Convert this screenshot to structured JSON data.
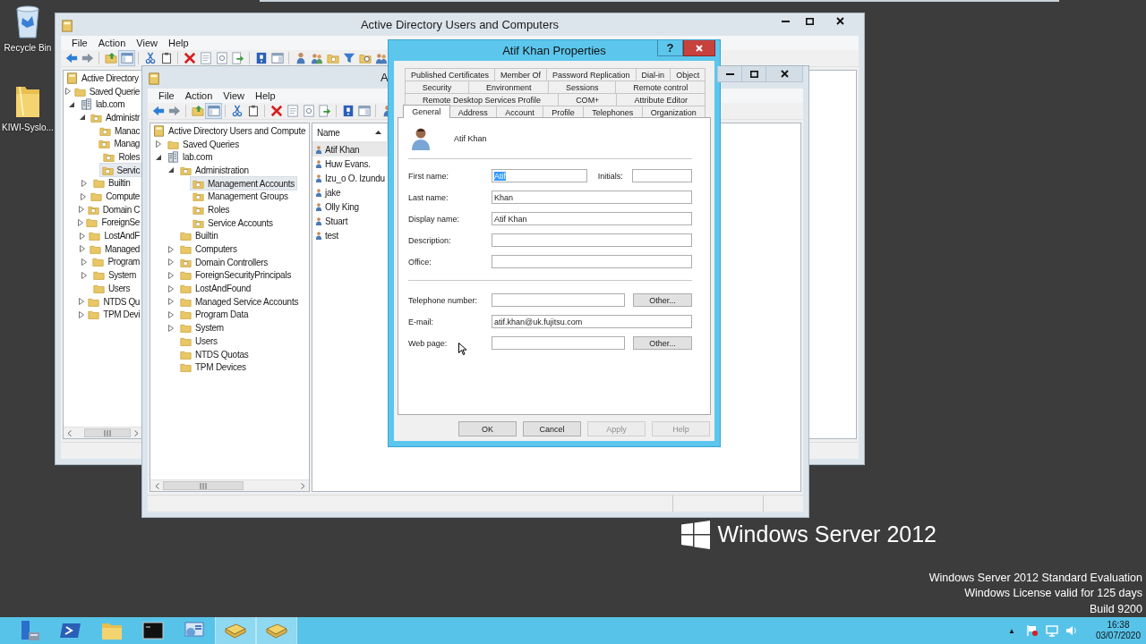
{
  "desktop_icons": [
    {
      "label": "Recycle Bin",
      "kind": "recycle-bin"
    },
    {
      "label": "KIWI-Syslo...",
      "kind": "folder"
    }
  ],
  "back_window": {
    "title": "Active Directory Users and Computers",
    "menu": [
      "File",
      "Action",
      "View",
      "Help"
    ],
    "tree": [
      {
        "label": "Active Directory",
        "kind": "root",
        "selected": false,
        "children": [
          {
            "label": "Saved Querie",
            "kind": "folder",
            "expanded": false,
            "selected": false
          },
          {
            "label": "lab.com",
            "kind": "domain",
            "expanded": true,
            "selected": false,
            "children": [
              {
                "label": "Administr",
                "kind": "ou",
                "expanded": true,
                "selected": false,
                "children": [
                  {
                    "label": "Manac",
                    "kind": "ou",
                    "selected": false
                  },
                  {
                    "label": "Manag",
                    "kind": "ou",
                    "selected": false
                  },
                  {
                    "label": "Roles",
                    "kind": "ou",
                    "selected": false
                  },
                  {
                    "label": "Servic",
                    "kind": "ou",
                    "selected": true
                  }
                ]
              },
              {
                "label": "Builtin",
                "kind": "folder",
                "expanded": false,
                "selected": false
              },
              {
                "label": "Compute",
                "kind": "folder",
                "expanded": false,
                "selected": false
              },
              {
                "label": "Domain C",
                "kind": "ou",
                "expanded": false,
                "selected": false
              },
              {
                "label": "ForeignSe",
                "kind": "folder",
                "expanded": false,
                "selected": false
              },
              {
                "label": "LostAndF",
                "kind": "folder",
                "expanded": false,
                "selected": false
              },
              {
                "label": "Managed",
                "kind": "folder",
                "expanded": false,
                "selected": false
              },
              {
                "label": "Program",
                "kind": "folder",
                "expanded": false,
                "selected": false
              },
              {
                "label": "System",
                "kind": "folder",
                "expanded": false,
                "selected": false
              },
              {
                "label": "Users",
                "kind": "folder",
                "selected": false
              },
              {
                "label": "NTDS Qu",
                "kind": "folder",
                "expanded": false,
                "selected": false
              },
              {
                "label": "TPM Devi",
                "kind": "folder",
                "expanded": false,
                "selected": false
              }
            ]
          }
        ]
      }
    ]
  },
  "front_window": {
    "title": "A",
    "menu": [
      "File",
      "Action",
      "View",
      "Help"
    ],
    "tree": [
      {
        "label": "Active Directory Users and Compute",
        "kind": "root",
        "selected": false,
        "children": [
          {
            "label": "Saved Queries",
            "kind": "folder",
            "expanded": false,
            "selected": false
          },
          {
            "label": "lab.com",
            "kind": "domain",
            "expanded": true,
            "selected": false,
            "children": [
              {
                "label": "Administration",
                "kind": "ou",
                "expanded": true,
                "selected": false,
                "children": [
                  {
                    "label": "Management Accounts",
                    "kind": "ou",
                    "selected": true
                  },
                  {
                    "label": "Management Groups",
                    "kind": "ou",
                    "selected": false
                  },
                  {
                    "label": "Roles",
                    "kind": "ou",
                    "selected": false
                  },
                  {
                    "label": "Service Accounts",
                    "kind": "ou",
                    "selected": false
                  }
                ]
              },
              {
                "label": "Builtin",
                "kind": "folder",
                "selected": false
              },
              {
                "label": "Computers",
                "kind": "folder",
                "expanded": false,
                "selected": false
              },
              {
                "label": "Domain Controllers",
                "kind": "ou",
                "expanded": false,
                "selected": false
              },
              {
                "label": "ForeignSecurityPrincipals",
                "kind": "folder",
                "expanded": false,
                "selected": false
              },
              {
                "label": "LostAndFound",
                "kind": "folder",
                "expanded": false,
                "selected": false
              },
              {
                "label": "Managed Service Accounts",
                "kind": "folder",
                "expanded": false,
                "selected": false
              },
              {
                "label": "Program Data",
                "kind": "folder",
                "expanded": false,
                "selected": false
              },
              {
                "label": "System",
                "kind": "folder",
                "expanded": false,
                "selected": false
              },
              {
                "label": "Users",
                "kind": "folder",
                "selected": false
              },
              {
                "label": "NTDS Quotas",
                "kind": "folder",
                "selected": false
              },
              {
                "label": "TPM Devices",
                "kind": "folder",
                "selected": false
              }
            ]
          }
        ]
      }
    ],
    "list": {
      "column": "Name",
      "rows": [
        {
          "name": "Atif Khan",
          "selected": true
        },
        {
          "name": "Huw Evans.",
          "selected": false
        },
        {
          "name": "Izu_o O. Izundu",
          "selected": false
        },
        {
          "name": "jake",
          "selected": false
        },
        {
          "name": "Olly King",
          "selected": false
        },
        {
          "name": "Stuart",
          "selected": false
        },
        {
          "name": "test",
          "selected": false
        }
      ]
    }
  },
  "dialog": {
    "title": "Atif Khan Properties",
    "help_glyph": "?",
    "tab_rows": [
      [
        {
          "label": "Published Certificates",
          "selected": false
        },
        {
          "label": "Member Of",
          "selected": false
        },
        {
          "label": "Password Replication",
          "selected": false
        },
        {
          "label": "Dial-in",
          "selected": false
        },
        {
          "label": "Object",
          "selected": false
        }
      ],
      [
        {
          "label": "Security",
          "selected": false
        },
        {
          "label": "Environment",
          "selected": false
        },
        {
          "label": "Sessions",
          "selected": false
        },
        {
          "label": "Remote control",
          "selected": false
        }
      ],
      [
        {
          "label": "Remote Desktop Services Profile",
          "selected": false
        },
        {
          "label": "COM+",
          "selected": false
        },
        {
          "label": "Attribute Editor",
          "selected": false
        }
      ],
      [
        {
          "label": "General",
          "selected": true
        },
        {
          "label": "Address",
          "selected": false
        },
        {
          "label": "Account",
          "selected": false
        },
        {
          "label": "Profile",
          "selected": false
        },
        {
          "label": "Telephones",
          "selected": false
        },
        {
          "label": "Organization",
          "selected": false
        }
      ]
    ],
    "user_name": "Atif Khan",
    "field_groups": [
      [
        {
          "label": "First name:",
          "value": "Atif",
          "value_selected": true,
          "companion": {
            "label": "Initials:"
          }
        },
        {
          "label": "Last name:",
          "value": "Khan",
          "value_selected": false
        },
        {
          "label": "Display name:",
          "value": "Atif Khan",
          "value_selected": false
        },
        {
          "label": "Description:"
        },
        {
          "label": "Office:"
        }
      ],
      [
        {
          "label": "Telephone number:",
          "button": "Other..."
        },
        {
          "label": "E-mail:",
          "value": "atif.khan@uk.fujitsu.com",
          "value_selected": false
        },
        {
          "label": "Web page:",
          "button": "Other..."
        }
      ]
    ],
    "buttons": [
      {
        "label": "OK",
        "disabled": false
      },
      {
        "label": "Cancel",
        "disabled": false
      },
      {
        "label": "Apply",
        "disabled": true
      },
      {
        "label": "Help",
        "disabled": true
      }
    ]
  },
  "branding": {
    "product": "Windows Server 2012",
    "notice": [
      "Windows Server 2012 Standard Evaluation",
      "Windows License valid for 125 days",
      "Build 9200"
    ]
  },
  "taskbar": {
    "apps": [
      {
        "kind": "server",
        "active": false
      },
      {
        "kind": "prompt",
        "active": false
      },
      {
        "kind": "folder",
        "active": false
      },
      {
        "kind": "console",
        "active": false
      },
      {
        "kind": "tools",
        "active": false
      },
      {
        "kind": "book",
        "active": true
      },
      {
        "kind": "book",
        "active": true
      }
    ],
    "tray_arrow": "▲",
    "time": "16:38",
    "date": "03/07/2020"
  }
}
